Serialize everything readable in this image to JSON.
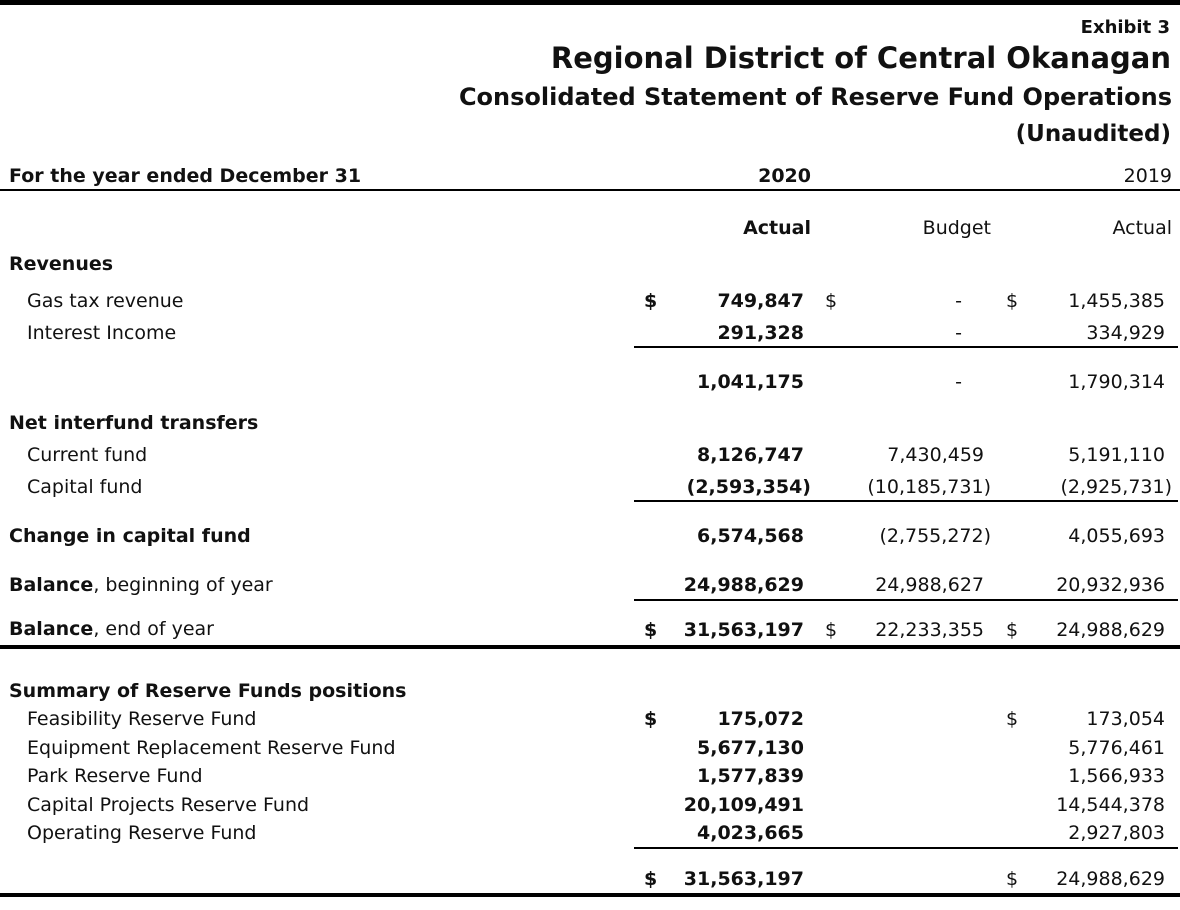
{
  "header": {
    "exhibit": "Exhibit 3",
    "org": "Regional District of Central Okanagan",
    "statement": "Consolidated Statement of Reserve Fund Operations",
    "note": "(Unaudited)"
  },
  "columns": {
    "period_label": "For the year ended December 31",
    "year_current": "2020",
    "year_prior": "2019",
    "actual_current": "Actual",
    "budget": "Budget",
    "actual_prior": "Actual"
  },
  "revenues": {
    "heading": "Revenues",
    "gas_tax": {
      "label": "Gas tax revenue",
      "cur_sym": "$",
      "cur": "749,847",
      "bud_sym": "$",
      "bud": "-",
      "prior_sym": "$",
      "prior": "1,455,385"
    },
    "interest": {
      "label": "Interest Income",
      "cur": "291,328",
      "bud": "-",
      "prior": "334,929"
    },
    "total": {
      "cur": "1,041,175",
      "bud": "-",
      "prior": "1,790,314"
    }
  },
  "transfers": {
    "heading": "Net interfund transfers",
    "current_fund": {
      "label": "Current fund",
      "cur": "8,126,747",
      "bud": "7,430,459",
      "prior": "5,191,110"
    },
    "capital_fund": {
      "label": "Capital fund",
      "cur": "(2,593,354)",
      "bud": "(10,185,731)",
      "prior": "(2,925,731)"
    }
  },
  "change": {
    "label": "Change in capital fund",
    "cur": "6,574,568",
    "bud": "(2,755,272)",
    "prior": "4,055,693"
  },
  "balance_begin": {
    "label_bold": "Balance",
    "label_rest": ", beginning of year",
    "cur": "24,988,629",
    "bud": "24,988,627",
    "prior": "20,932,936"
  },
  "balance_end": {
    "label_bold": "Balance",
    "label_rest": ", end of year",
    "cur_sym": "$",
    "cur": "31,563,197",
    "bud_sym": "$",
    "bud": "22,233,355",
    "prior_sym": "$",
    "prior": "24,988,629"
  },
  "summary": {
    "heading": "Summary of Reserve Funds positions",
    "rows": [
      {
        "label": "Feasibility Reserve Fund",
        "cur_sym": "$",
        "cur": "175,072",
        "prior_sym": "$",
        "prior": "173,054"
      },
      {
        "label": "Equipment Replacement Reserve Fund",
        "cur": "5,677,130",
        "prior": "5,776,461"
      },
      {
        "label": "Park Reserve Fund",
        "cur": "1,577,839",
        "prior": "1,566,933"
      },
      {
        "label": "Capital Projects Reserve Fund",
        "cur": "20,109,491",
        "prior": "14,544,378"
      },
      {
        "label": "Operating Reserve Fund",
        "cur": "4,023,665",
        "prior": "2,927,803"
      }
    ],
    "total": {
      "cur_sym": "$",
      "cur": "31,563,197",
      "prior_sym": "$",
      "prior": "24,988,629"
    }
  }
}
